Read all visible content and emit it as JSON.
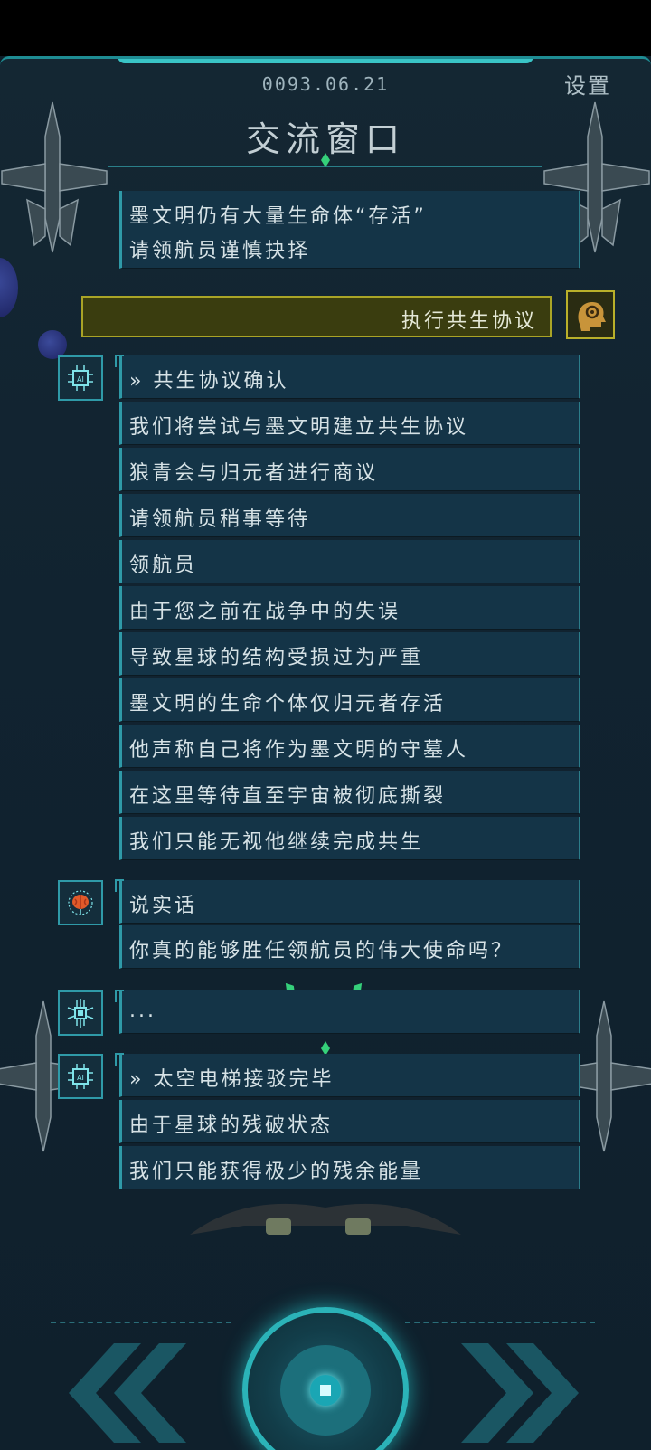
{
  "header": {
    "date": "0093.06.21",
    "settings_label": "设置",
    "title": "交流窗口"
  },
  "dialog": {
    "top_messages": [
      "墨文明仍有大量生命体“存活”",
      "请领航员谨慎抉择"
    ],
    "player_choice": "执行共生协议",
    "ai_group_1": [
      "» 共生协议确认",
      "我们将尝试与墨文明建立共生协议",
      "狼青会与归元者进行商议",
      "请领航员稍事等待",
      "领航员",
      "由于您之前在战争中的失误",
      "导致星球的结构受损过为严重",
      "墨文明的生命个体仅归元者存活",
      "他声称自己将作为墨文明的守墓人",
      "在这里等待直至宇宙被彻底撕裂",
      "我们只能无视他继续完成共生"
    ],
    "brain_group": [
      "说实话",
      "你真的能够胜任领航员的伟大使命吗？"
    ],
    "chip_group": [
      "..."
    ],
    "ai_group_2": [
      "» 太空电梯接驳完毕",
      "由于星球的残破状态",
      "我们只能获得极少的残余能量"
    ]
  },
  "icons": {
    "ai_chip": "ai-chip-icon",
    "brain": "brain-icon",
    "circuit_chip": "circuit-chip-icon",
    "player_head": "head-gear-icon",
    "rewind": "double-chevron-left-icon",
    "forward": "double-chevron-right-icon"
  },
  "colors": {
    "accent": "#2bb3b8",
    "player_bar": "#a9a426",
    "message_bg": "#143447"
  }
}
